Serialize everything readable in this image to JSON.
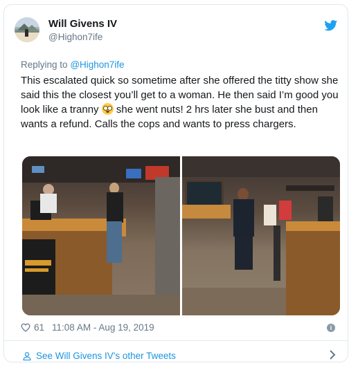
{
  "author": {
    "name": "Will Givens IV",
    "handle": "@Highon7ife"
  },
  "reply": {
    "prefix": "Replying to",
    "to": "@Highon7ife"
  },
  "tweet": {
    "text_part1": "This escalated quick so sometime after she offered the titty show she said this the closest you’ll get to a woman. He then said I’m good you look like a tranny",
    "text_part2": "she went nuts! 2 hrs later she bust and then wants a refund. Calls the cops and wants to press chargers.",
    "emoji": "flushed-face-emoji"
  },
  "meta": {
    "likes": "61",
    "timestamp": "11:08 AM - Aug 19, 2019"
  },
  "footer": {
    "more_tweets": "See Will Givens IV's other Tweets"
  },
  "colors": {
    "accent": "#1b95e0",
    "muted": "#657786",
    "border": "#e1e8ed"
  }
}
